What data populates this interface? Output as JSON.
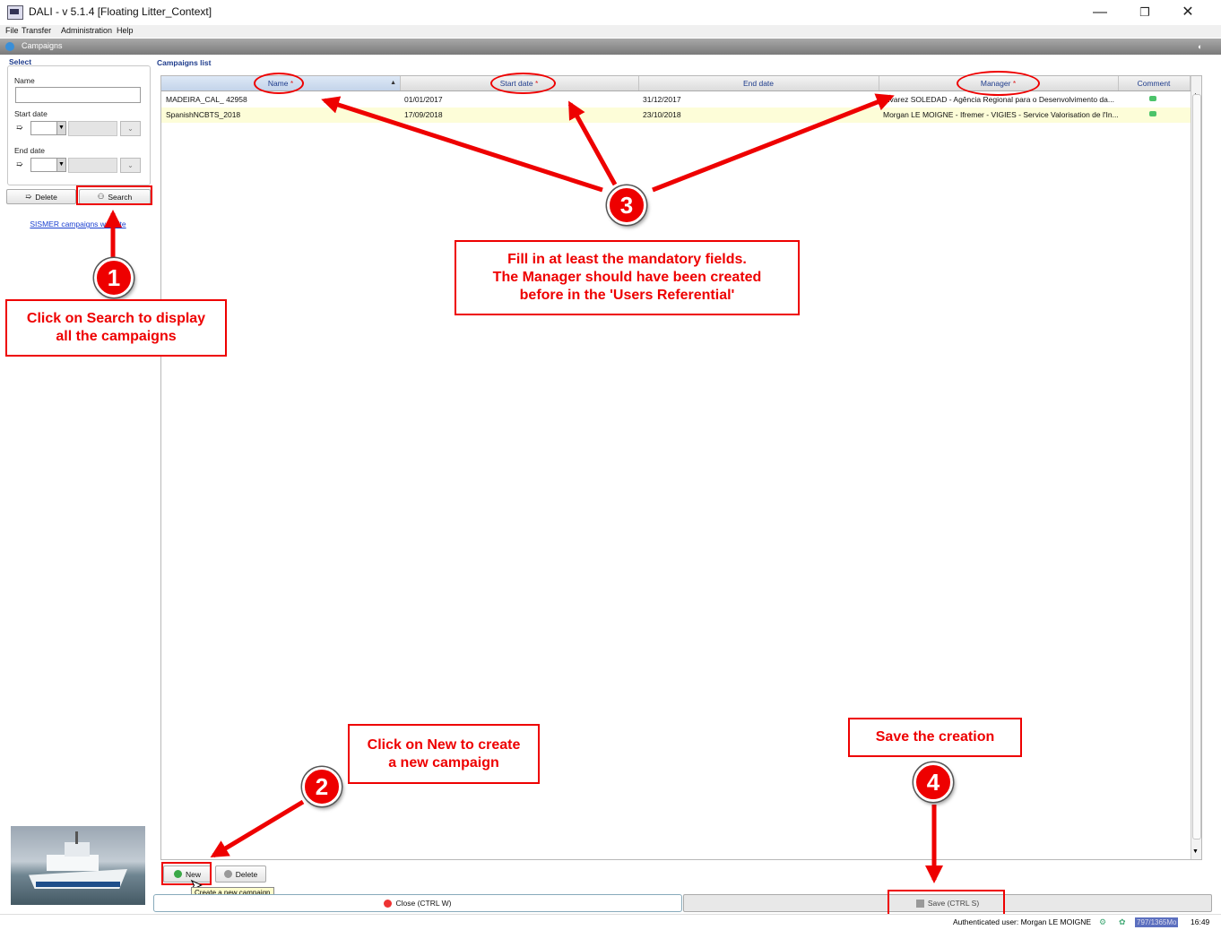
{
  "window": {
    "title": "DALI - v 5.1.4 [Floating Litter_Context]",
    "controls": {
      "minimize": "—",
      "restore": "❐",
      "close": "✕"
    }
  },
  "menu": [
    "File",
    "Transfer",
    "Administration",
    "Help"
  ],
  "section": {
    "title": "Campaigns"
  },
  "select_panel": {
    "title": "Select",
    "name_label": "Name",
    "name_value": "",
    "start_date_label": "Start date",
    "end_date_label": "End date",
    "delete_label": "Delete",
    "search_label": "Search",
    "link": "SISMER campaigns website"
  },
  "campaigns": {
    "title": "Campaigns list",
    "columns": [
      {
        "label": "Name",
        "mandatory": "*",
        "sort": "▲"
      },
      {
        "label": "Start date",
        "mandatory": "*"
      },
      {
        "label": "End date",
        "mandatory": ""
      },
      {
        "label": "Manager",
        "mandatory": "*"
      },
      {
        "label": "Comment",
        "mandatory": ""
      }
    ],
    "rows": [
      {
        "name": "MADEIRA_CAL_ 42958",
        "start": "01/01/2017",
        "end": "31/12/2017",
        "manager": "Alvarez SOLEDAD - Agência Regional para o Desenvolvimento da..."
      },
      {
        "name": "SpanishNCBTS_2018",
        "start": "17/09/2018",
        "end": "23/10/2018",
        "manager": "Morgan LE MOIGNE - Ifremer - VIGIES - Service Valorisation de l'In..."
      }
    ]
  },
  "bottom": {
    "new_label": "New",
    "delete_label": "Delete",
    "tooltip": "Create a new campaign",
    "close_label": "Close (CTRL W)",
    "save_label": "Save (CTRL S)"
  },
  "status": {
    "user": "Authenticated user: Morgan LE MOIGNE",
    "memory": "797/1365Mo",
    "time": "16:49"
  },
  "annotations": {
    "step1": "1",
    "step2": "2",
    "step3": "3",
    "step4": "4",
    "callout1_line1": "Click on Search to display",
    "callout1_line2": "all the campaigns",
    "callout2_line1": "Click on New to create",
    "callout2_line2": "a new campaign",
    "callout3_line1": "Fill in at least the mandatory fields.",
    "callout3_line2": "The Manager should have been created",
    "callout3_line3": "before in the 'Users Referential'",
    "callout4": "Save the creation"
  },
  "colors": {
    "annotation": "#e00000",
    "header_text": "#1e3c8c",
    "selected_row": "#fdfdd8"
  }
}
